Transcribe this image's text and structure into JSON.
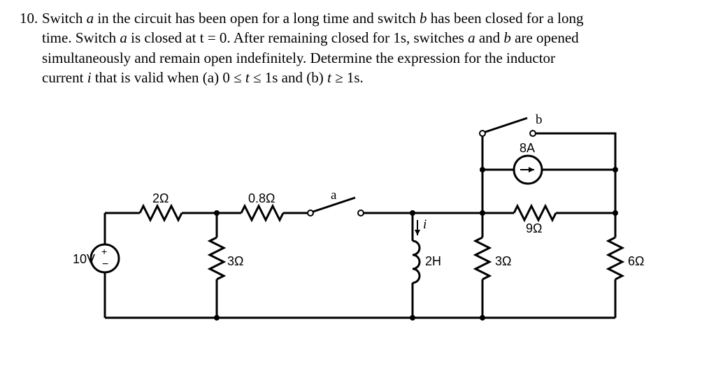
{
  "problem": {
    "number": "10.",
    "line1": "Switch ",
    "a": "a",
    "line2": " in the circuit has been open for a long time and switch ",
    "b": "b",
    "line3": " has been closed for a long",
    "line4": "time.  Switch ",
    "line5": " is closed at t = 0.  After remaining closed for 1s, switches ",
    "line6": " and ",
    "line7": " are opened",
    "line8": "simultaneously and remain open indefinitely.  Determine the expression for the inductor",
    "line9": "current ",
    "i": "i",
    "line10": " that is valid when (a) 0 ≤ ",
    "t": "t",
    "line11": " ≤ 1s and (b) ",
    "line12": " ≥ 1s."
  },
  "components": {
    "v_source": "10V",
    "r_2ohm": "2Ω",
    "r_3ohm_left": "3Ω",
    "r_08ohm": "0.8Ω",
    "switch_a": "a",
    "inductor": "2H",
    "i_label": "i",
    "r_3ohm_right": "3Ω",
    "i_source": "8A",
    "switch_b": "b",
    "r_9ohm": "9Ω",
    "r_6ohm": "6Ω"
  }
}
